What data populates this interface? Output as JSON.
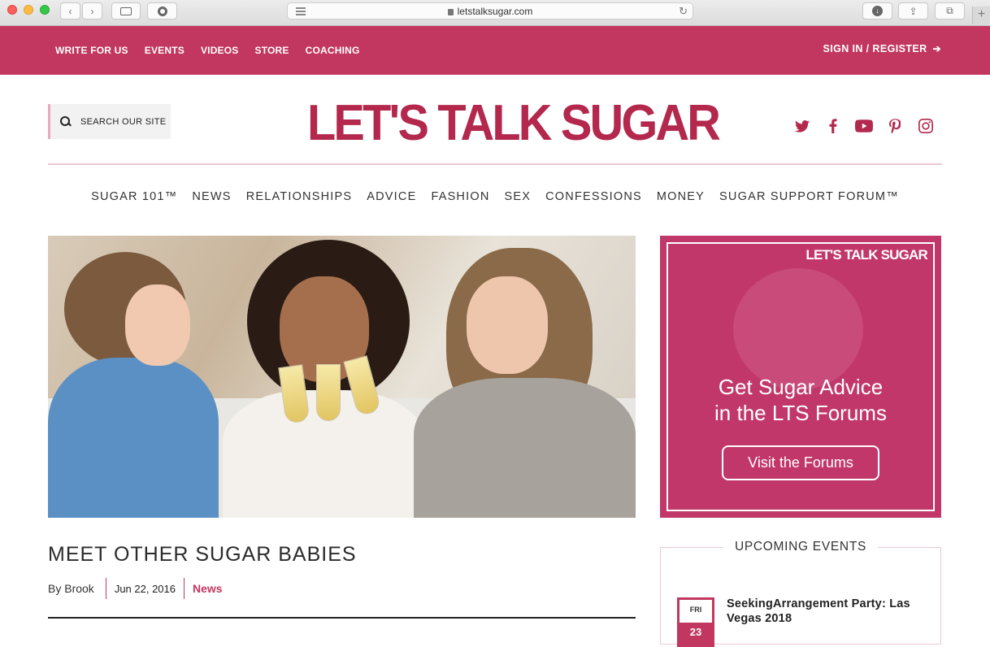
{
  "browser": {
    "url": "letstalksugar.com"
  },
  "topbar": {
    "nav": [
      "WRITE FOR US",
      "EVENTS",
      "VIDEOS",
      "STORE",
      "COACHING"
    ],
    "signin": "SIGN IN / REGISTER"
  },
  "header": {
    "search_placeholder": "SEARCH OUR SITE",
    "logo": "LET'S TALK SUGAR",
    "social": [
      "twitter-icon",
      "facebook-icon",
      "youtube-icon",
      "pinterest-icon",
      "instagram-icon"
    ]
  },
  "mainnav": [
    "SUGAR 101™",
    "NEWS",
    "RELATIONSHIPS",
    "ADVICE",
    "FASHION",
    "SEX",
    "CONFESSIONS",
    "MONEY",
    "SUGAR SUPPORT FORUM™"
  ],
  "ad": {
    "brand": "LET'S TALK SUGAR",
    "headline_line1": "Get Sugar Advice",
    "headline_line2": "in the LTS Forums",
    "cta": "Visit the Forums"
  },
  "article": {
    "title": "MEET OTHER SUGAR BABIES",
    "author": "By Brook",
    "date": "Jun 22, 2016",
    "category": "News"
  },
  "events": {
    "title": "UPCOMING EVENTS",
    "items": [
      {
        "dow": "FRI",
        "day": "23",
        "name": "SeekingArrangement Party: Las Vegas 2018"
      }
    ]
  },
  "colors": {
    "brand": "#c2375f",
    "logo": "#b3284c"
  }
}
